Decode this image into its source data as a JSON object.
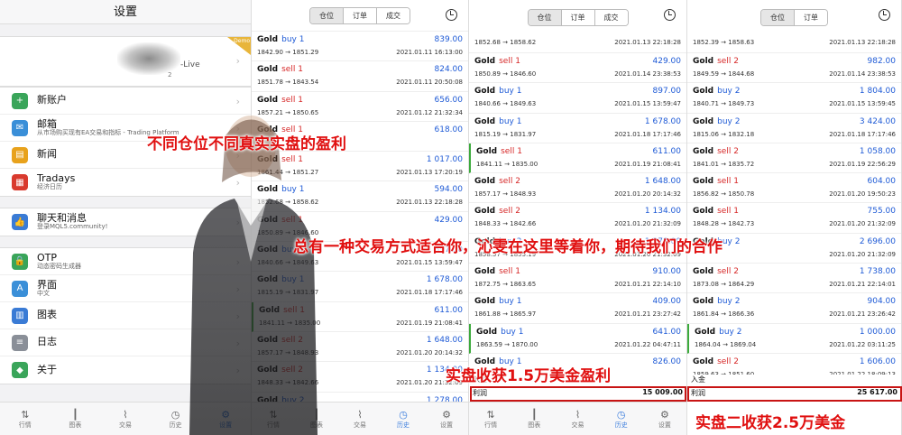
{
  "settings": {
    "title": "设置",
    "account": {
      "name_suffix": "-Live",
      "sub": "2",
      "badge": "Demo"
    },
    "groups": [
      [
        {
          "label": "新账户",
          "sub": "",
          "icon": "plus-icon",
          "color": "#3aa55a",
          "glyph": "+"
        },
        {
          "label": "邮箱",
          "sub": "从市场购买现有EA交易和指标 - Trading Platform",
          "icon": "mail-icon",
          "color": "#3a8fd8",
          "glyph": "✉"
        },
        {
          "label": "新闻",
          "sub": "",
          "icon": "news-icon",
          "color": "#e8a21c",
          "glyph": "▤"
        },
        {
          "label": "Tradays",
          "sub": "经济日历",
          "icon": "calendar-icon",
          "color": "#d93a2e",
          "glyph": "▦"
        }
      ],
      [
        {
          "label": "聊天和消息",
          "sub": "登录MQL5.community!",
          "icon": "chat-icon",
          "color": "#3a7bd5",
          "glyph": "👍"
        }
      ],
      [
        {
          "label": "OTP",
          "sub": "动态密码生成器",
          "icon": "otp-icon",
          "color": "#3aa55a",
          "glyph": "🔒"
        },
        {
          "label": "界面",
          "sub": "中文",
          "icon": "language-icon",
          "color": "#3a8fd8",
          "glyph": "A"
        },
        {
          "label": "图表",
          "sub": "",
          "icon": "chart-settings-icon",
          "color": "#3a7bd5",
          "glyph": "▥"
        },
        {
          "label": "日志",
          "sub": "",
          "icon": "log-icon",
          "color": "#8a8f98",
          "glyph": "≡"
        },
        {
          "label": "关于",
          "sub": "",
          "icon": "about-icon",
          "color": "#3aa55a",
          "glyph": "◆"
        }
      ]
    ]
  },
  "tabs": [
    {
      "label": "行情",
      "icon": "quotes-icon",
      "glyph": "⇅"
    },
    {
      "label": "图表",
      "icon": "chart-icon",
      "glyph": "┃"
    },
    {
      "label": "交易",
      "icon": "trade-icon",
      "glyph": "⌇"
    },
    {
      "label": "历史",
      "icon": "history-icon",
      "glyph": "◷"
    },
    {
      "label": "设置",
      "icon": "settings-icon",
      "glyph": "⚙"
    }
  ],
  "segments": {
    "positions": "仓位",
    "orders": "订单",
    "deals": "成交"
  },
  "panel2": {
    "rows": [
      {
        "symbol": "Gold",
        "side": "buy",
        "lots": "1",
        "prices": "1842.90 → 1851.29",
        "time": "2021.01.11 16:13:00",
        "profit": "839.00",
        "mark": false
      },
      {
        "symbol": "Gold",
        "side": "sell",
        "lots": "1",
        "prices": "1851.78 → 1843.54",
        "time": "2021.01.11 20:50:08",
        "profit": "824.00",
        "mark": false
      },
      {
        "symbol": "Gold",
        "side": "sell",
        "lots": "1",
        "prices": "1857.21 → 1850.65",
        "time": "2021.01.12 21:32:34",
        "profit": "656.00",
        "mark": false
      },
      {
        "symbol": "Gold",
        "side": "sell",
        "lots": "1",
        "prices": "",
        "time": "",
        "profit": "618.00",
        "mark": false
      },
      {
        "symbol": "Gold",
        "side": "sell",
        "lots": "1",
        "prices": "1861.44 → 1851.27",
        "time": "2021.01.13 17:20:19",
        "profit": "1 017.00",
        "mark": false
      },
      {
        "symbol": "Gold",
        "side": "buy",
        "lots": "1",
        "prices": "1852.68 → 1858.62",
        "time": "2021.01.13 22:18:28",
        "profit": "594.00",
        "mark": false
      },
      {
        "symbol": "Gold",
        "side": "sell",
        "lots": "1",
        "prices": "1850.89 → 1846.60",
        "time": "",
        "profit": "429.00",
        "mark": false
      },
      {
        "symbol": "Gold",
        "side": "buy",
        "lots": "1",
        "prices": "1840.66 → 1849.63",
        "time": "2021.01.15 13:59:47",
        "profit": "897.00",
        "mark": false
      },
      {
        "symbol": "Gold",
        "side": "buy",
        "lots": "1",
        "prices": "1815.19 → 1831.97",
        "time": "2021.01.18 17:17:46",
        "profit": "1 678.00",
        "mark": false
      },
      {
        "symbol": "Gold",
        "side": "sell",
        "lots": "1",
        "prices": "1841.11 → 1835.00",
        "time": "2021.01.19 21:08:41",
        "profit": "611.00",
        "mark": true
      },
      {
        "symbol": "Gold",
        "side": "sell",
        "lots": "2",
        "prices": "1857.17 → 1848.93",
        "time": "2021.01.20 20:14:32",
        "profit": "1 648.00",
        "mark": false
      },
      {
        "symbol": "Gold",
        "side": "sell",
        "lots": "2",
        "prices": "1848.33 → 1842.66",
        "time": "2021.01.20 21:32:09",
        "profit": "1 134.00",
        "mark": false
      },
      {
        "symbol": "Gold",
        "side": "buy",
        "lots": "2",
        "prices": "",
        "time": "",
        "profit": "1 278.00",
        "mark": false
      }
    ]
  },
  "panel3": {
    "top_partial": {
      "prices": "1852.68 → 1858.62",
      "time": "2021.01.13 22:18:28"
    },
    "rows": [
      {
        "symbol": "Gold",
        "side": "sell",
        "lots": "1",
        "prices": "1850.89 → 1846.60",
        "time": "2021.01.14 23:38:53",
        "profit": "429.00",
        "mark": false
      },
      {
        "symbol": "Gold",
        "side": "buy",
        "lots": "1",
        "prices": "1840.66 → 1849.63",
        "time": "2021.01.15 13:59:47",
        "profit": "897.00",
        "mark": false
      },
      {
        "symbol": "Gold",
        "side": "buy",
        "lots": "1",
        "prices": "1815.19 → 1831.97",
        "time": "2021.01.18 17:17:46",
        "profit": "1 678.00",
        "mark": false
      },
      {
        "symbol": "Gold",
        "side": "sell",
        "lots": "1",
        "prices": "1841.11 → 1835.00",
        "time": "2021.01.19 21:08:41",
        "profit": "611.00",
        "mark": true
      },
      {
        "symbol": "Gold",
        "side": "sell",
        "lots": "2",
        "prices": "1857.17 → 1848.93",
        "time": "2021.01.20 20:14:32",
        "profit": "1 648.00",
        "mark": false
      },
      {
        "symbol": "Gold",
        "side": "sell",
        "lots": "2",
        "prices": "1848.33 → 1842.66",
        "time": "2021.01.20 21:32:09",
        "profit": "1 134.00",
        "mark": false
      },
      {
        "symbol": "Gold",
        "side": "buy",
        "lots": "2",
        "prices": "1858.57 → 1855.19",
        "time": "2021.01.20 21:32:09",
        "profit": "1 278.00",
        "mark": false
      },
      {
        "symbol": "Gold",
        "side": "sell",
        "lots": "1",
        "prices": "1872.75 → 1863.65",
        "time": "2021.01.21 22:14:10",
        "profit": "910.00",
        "mark": false
      },
      {
        "symbol": "Gold",
        "side": "buy",
        "lots": "1",
        "prices": "1861.88 → 1865.97",
        "time": "2021.01.21 23:27:42",
        "profit": "409.00",
        "mark": false
      },
      {
        "symbol": "Gold",
        "side": "buy",
        "lots": "1",
        "prices": "1863.59 → 1870.00",
        "time": "2021.01.22 04:47:11",
        "profit": "641.00",
        "mark": true
      },
      {
        "symbol": "Gold",
        "side": "buy",
        "lots": "1",
        "prices": "",
        "time": "",
        "profit": "826.00",
        "mark": false
      }
    ],
    "deposit_label": "入金",
    "profit_label": "利润",
    "profit_total": "15 009.00"
  },
  "panel4": {
    "top_partial": {
      "prices": "1852.39 → 1858.63",
      "time": "2021.01.13 22:18:28"
    },
    "rows": [
      {
        "symbol": "Gold",
        "side": "sell",
        "lots": "2",
        "prices": "1849.59 → 1844.68",
        "time": "2021.01.14 23:38:53",
        "profit": "982.00",
        "mark": false
      },
      {
        "symbol": "Gold",
        "side": "buy",
        "lots": "2",
        "prices": "1840.71 → 1849.73",
        "time": "2021.01.15 13:59:45",
        "profit": "1 804.00",
        "mark": false
      },
      {
        "symbol": "Gold",
        "side": "buy",
        "lots": "2",
        "prices": "1815.06 → 1832.18",
        "time": "2021.01.18 17:17:46",
        "profit": "3 424.00",
        "mark": false
      },
      {
        "symbol": "Gold",
        "side": "sell",
        "lots": "2",
        "prices": "1841.01 → 1835.72",
        "time": "2021.01.19 22:56:29",
        "profit": "1 058.00",
        "mark": false
      },
      {
        "symbol": "Gold",
        "side": "sell",
        "lots": "1",
        "prices": "1856.82 → 1850.78",
        "time": "2021.01.20 19:50:23",
        "profit": "604.00",
        "mark": false
      },
      {
        "symbol": "Gold",
        "side": "sell",
        "lots": "1",
        "prices": "1848.28 → 1842.73",
        "time": "2021.01.20 21:32:09",
        "profit": "755.00",
        "mark": false
      },
      {
        "symbol": "Gold",
        "side": "buy",
        "lots": "2",
        "prices": "",
        "time": "2021.01.20 21:32:09",
        "profit": "2 696.00",
        "mark": false
      },
      {
        "symbol": "Gold",
        "side": "sell",
        "lots": "2",
        "prices": "1873.08 → 1864.29",
        "time": "2021.01.21 22:14:01",
        "profit": "1 738.00",
        "mark": false
      },
      {
        "symbol": "Gold",
        "side": "buy",
        "lots": "2",
        "prices": "1861.84 → 1866.36",
        "time": "2021.01.21 23:26:42",
        "profit": "904.00",
        "mark": false
      },
      {
        "symbol": "Gold",
        "side": "buy",
        "lots": "2",
        "prices": "1864.04 → 1869.04",
        "time": "2021.01.22 03:11:25",
        "profit": "1 000.00",
        "mark": true
      },
      {
        "symbol": "Gold",
        "side": "sell",
        "lots": "2",
        "prices": "1859.63 → 1851.60",
        "time": "2021.01.22 18:09:13",
        "profit": "1 606.00",
        "mark": false
      }
    ],
    "deposit_label": "入金",
    "profit_label": "利润",
    "profit_total": "25 617.00"
  },
  "overlays": {
    "caption1": "不同仓位不同真实实盘的盈利",
    "caption2": "总有一种交易方式适合你，沁雯在这里等着你，期待我们的合作",
    "caption3": "实盘收获1.5万美金盈利",
    "caption4": "实盘二收获2.5万美金"
  }
}
